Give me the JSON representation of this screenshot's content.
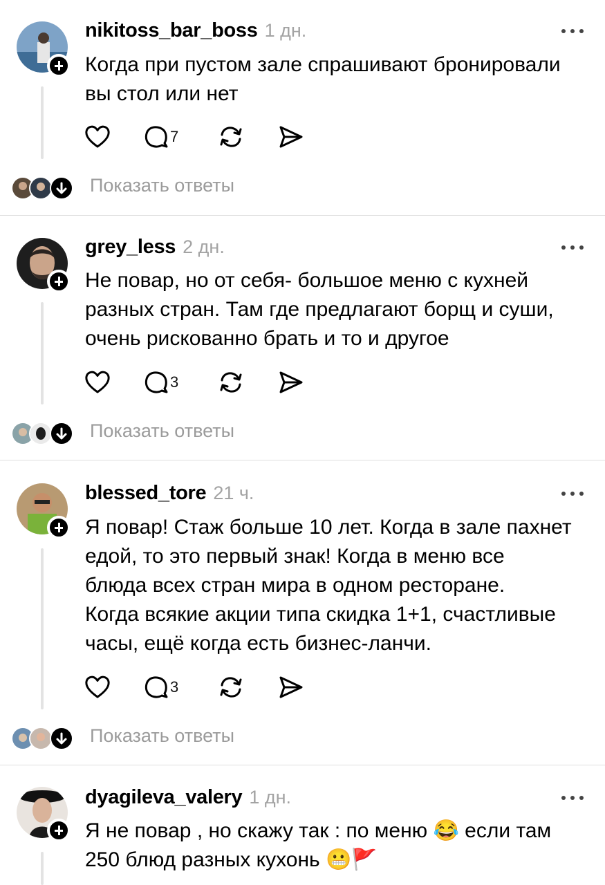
{
  "posts": [
    {
      "username": "nikitoss_bar_boss",
      "time": "1 дн.",
      "text_lines": [
        "Когда при пустом зале спрашивают бронировали",
        "вы стол или нет"
      ],
      "reply_count": "7",
      "show_replies": "Показать ответы"
    },
    {
      "username": "grey_less",
      "time": "2 дн.",
      "text_lines": [
        "Не повар, но от себя- большое меню с кухней",
        "разных стран. Там где предлагают борщ и суши,",
        "очень рискованно брать и то и другое"
      ],
      "reply_count": "3",
      "show_replies": "Показать ответы"
    },
    {
      "username": "blessed_tore",
      "time": "21 ч.",
      "text_lines": [
        "Я повар! Стаж больше 10 лет. Когда в зале пахнет",
        "едой, то это первый знак! Когда в меню все",
        "блюда всех стран мира в одном ресторане.",
        "Когда всякие акции типа скидка 1+1, счастливые",
        "часы, ещё когда есть бизнес-ланчи."
      ],
      "reply_count": "3",
      "show_replies": "Показать ответы"
    },
    {
      "username": "dyagileva_valery",
      "time": "1 дн.",
      "text_lines": [
        "Я не повар , но скажу так : по меню 😂 если там",
        "250 блюд разных кухонь 😬🚩"
      ]
    }
  ],
  "icons": {
    "like": "heart-icon",
    "comment": "comment-bubble-icon",
    "repost": "repost-icon",
    "share": "send-icon",
    "more": "more-dots-icon",
    "follow": "plus-icon",
    "expand": "arrow-down-icon"
  },
  "colors": {
    "muted": "#9b9b9b",
    "thread": "#e3e3e3",
    "separator": "#dedede"
  }
}
